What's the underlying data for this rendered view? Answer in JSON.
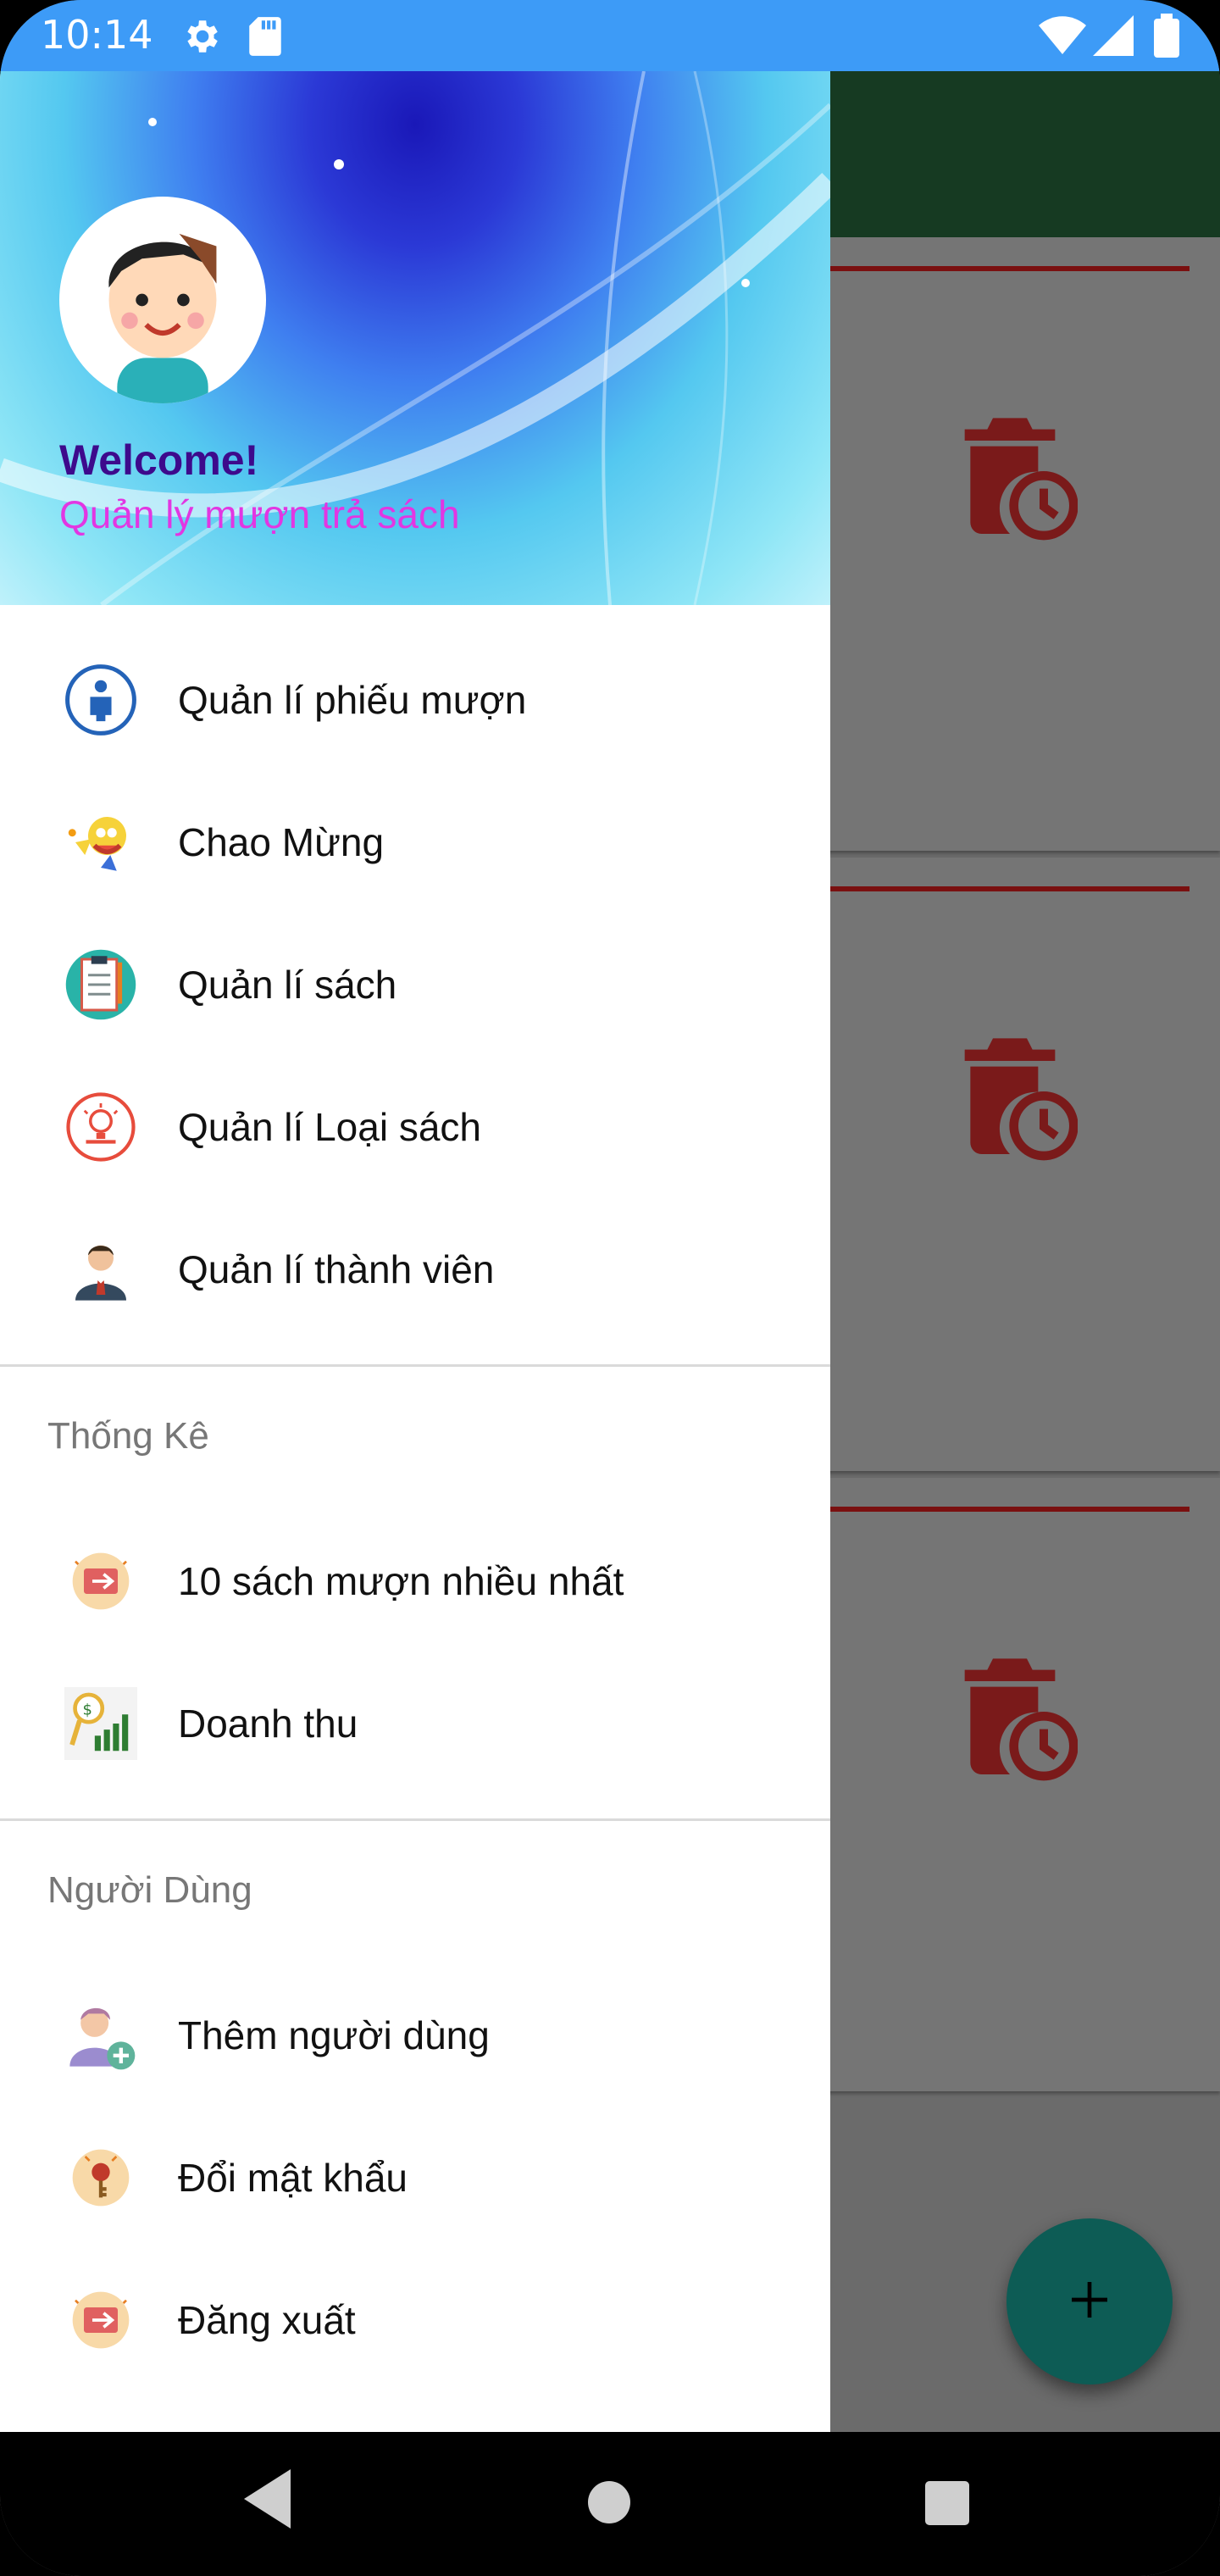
{
  "status_bar": {
    "time": "10:14"
  },
  "header": {
    "welcome": "Welcome!",
    "subtitle": "Quản lý mượn trả sách"
  },
  "menu": {
    "main_items": [
      {
        "label": "Quản lí phiếu mượn",
        "icon": "person-info-icon"
      },
      {
        "label": "Chao Mừng",
        "icon": "cartoon-character-icon"
      },
      {
        "label": "Quản lí sách",
        "icon": "clipboard-checklist-icon"
      },
      {
        "label": "Quản lí Loại sách",
        "icon": "lightbulb-badge-icon"
      },
      {
        "label": "Quản lí thành viên",
        "icon": "businessman-icon"
      }
    ],
    "stats_section": {
      "title": "Thống Kê",
      "items": [
        {
          "label": "10 sách mượn nhiều nhất",
          "icon": "logout-badge-icon"
        },
        {
          "label": "Doanh thu",
          "icon": "revenue-chart-icon"
        }
      ]
    },
    "user_section": {
      "title": "Người Dùng",
      "items": [
        {
          "label": "Thêm người dùng",
          "icon": "add-user-icon"
        },
        {
          "label": "Đổi mật khẩu",
          "icon": "key-badge-icon"
        },
        {
          "label": "Đăng xuất",
          "icon": "logout-badge-icon"
        }
      ]
    }
  },
  "colors": {
    "status_bar": "#3d9bf7",
    "toolbar": "#163a22",
    "welcome_text": "#3d0a8c",
    "subtitle_text": "#e236e2",
    "fab": "#0d5c55",
    "accent_red": "#7a1010"
  }
}
